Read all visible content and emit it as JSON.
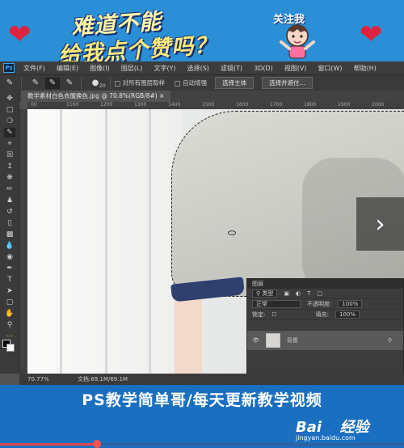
{
  "banner": {
    "line1": "难道不能",
    "line2": "给我点个赞吗？",
    "follow": "关注我"
  },
  "menu": {
    "logo": "Ps",
    "items": [
      "文件(F)",
      "编辑(E)",
      "图像(I)",
      "图层(L)",
      "文字(Y)",
      "选择(S)",
      "滤镜(T)",
      "3D(D)",
      "视图(V)",
      "窗口(W)",
      "帮助(H)"
    ]
  },
  "options": {
    "brush_size": "20",
    "sample_all": "对所有图层取样",
    "auto_enhance": "自动增强",
    "select_subject": "选择主体",
    "select_and_mask": "选择并遮住..."
  },
  "document": {
    "tab": "教学素材白色衣服换色.jpg @ 70.8%(RGB/8#)",
    "ruler": [
      "00",
      "1100",
      "1200",
      "1300",
      "1400",
      "1500",
      "1600",
      "1700",
      "1800",
      "1900",
      "2000"
    ]
  },
  "layers": {
    "title": "图层",
    "kind": "类型",
    "blend": "正常",
    "opacity_label": "不透明度:",
    "opacity": "100%",
    "lock_label": "锁定:",
    "fill_label": "填充:",
    "fill": "100%",
    "layer_name": "背景"
  },
  "status": {
    "zoom": "70.77%",
    "doc": "文档:69.1M/69.1M"
  },
  "caption": "PS教学简单哥/每天更新教学视频",
  "footer": {
    "logo": "Bai🐾经验",
    "url": "jingyan.baidu.com",
    "progress": 0.24
  },
  "colors": {
    "banner_bg": "#2a8fd6",
    "caption_bg": "#1a6fc0",
    "heart": "#e0233c",
    "ps_blue": "#31a8ff"
  }
}
